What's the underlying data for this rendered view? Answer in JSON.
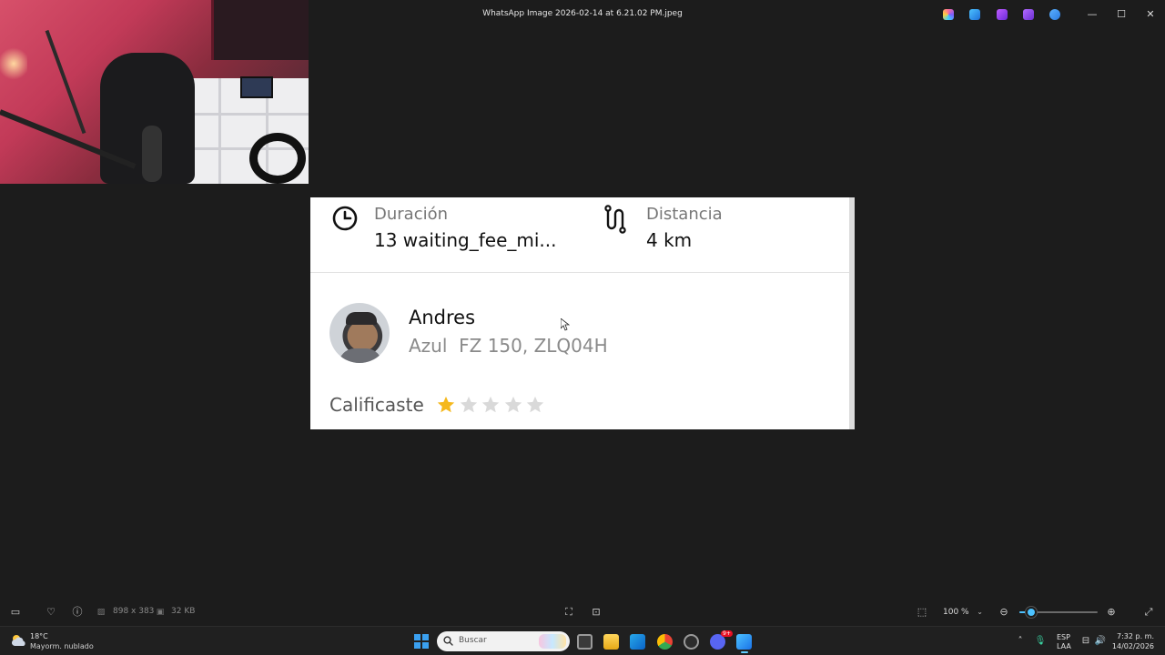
{
  "window": {
    "title": "WhatsApp Image 2026-02-14 at 6.21.02 PM.jpeg",
    "controls": {
      "minimize": "—",
      "maximize": "☐",
      "close": "✕"
    }
  },
  "image_content": {
    "duration": {
      "label": "Duración",
      "value": "13 waiting_fee_mi..."
    },
    "distance": {
      "label": "Distancia",
      "value": "4 km"
    },
    "driver": {
      "name": "Andres",
      "vehicle": "Azul  FZ 150, ZLQ04H"
    },
    "rating": {
      "label": "Calificaste",
      "value": 1,
      "max": 5,
      "filled_color": "#f5b81c",
      "empty_color": "#d9d9d9"
    }
  },
  "viewer_bar": {
    "dimensions": "898 x 383",
    "file_size": "32 KB",
    "zoom": "100 %",
    "zoom_level": 0.15
  },
  "taskbar": {
    "weather": {
      "temp": "18°C",
      "desc": "Mayorm. nublado"
    },
    "search_placeholder": "Buscar",
    "language": {
      "line1": "ESP",
      "line2": "LAA"
    },
    "clock": {
      "time": "7:32 p. m.",
      "date": "14/02/2026"
    },
    "badge": "9+"
  },
  "colors": {
    "accent": "#4cc2ff",
    "background": "#1c1c1c",
    "taskbar": "#202020"
  }
}
